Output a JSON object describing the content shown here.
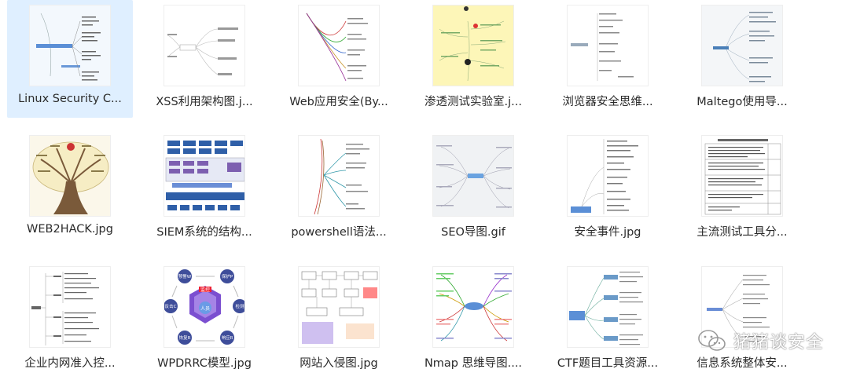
{
  "files": [
    {
      "name": "Linux Security C...",
      "icon": "mindmap-light-blue-icon",
      "selected": true
    },
    {
      "name": "XSS利用架构图.j...",
      "icon": "mindmap-xss-icon"
    },
    {
      "name": "Web应用安全(By...",
      "icon": "mindmap-web-security-icon"
    },
    {
      "name": "渗透测试实验室.j...",
      "icon": "mindmap-yellow-icon"
    },
    {
      "name": "浏览器安全思维...",
      "icon": "mindmap-browser-icon"
    },
    {
      "name": "Maltego使用导...",
      "icon": "mindmap-maltego-icon"
    },
    {
      "name": "WEB2HACK.jpg",
      "icon": "tree-diagram-icon"
    },
    {
      "name": "SIEM系统的结构...",
      "icon": "siem-architecture-icon"
    },
    {
      "name": "powershell语法...",
      "icon": "mindmap-powershell-icon"
    },
    {
      "name": "SEO导图.gif",
      "icon": "mindmap-seo-icon"
    },
    {
      "name": "安全事件.jpg",
      "icon": "mindmap-events-icon"
    },
    {
      "name": "主流测试工具分...",
      "icon": "table-document-icon"
    },
    {
      "name": "企业内网准入控...",
      "icon": "mindmap-intranet-icon"
    },
    {
      "name": "WPDRRC模型.jpg",
      "icon": "wpdrrc-model-icon"
    },
    {
      "name": "网站入侵图.jpg",
      "icon": "flowchart-intrusion-icon"
    },
    {
      "name": "Nmap 思维导图....",
      "icon": "mindmap-nmap-icon"
    },
    {
      "name": "CTF题目工具资源...",
      "icon": "mindmap-ctf-icon"
    },
    {
      "name": "信息系统整体安...",
      "icon": "mindmap-infosys-icon"
    }
  ],
  "wpdrrc": {
    "center_top": "监控",
    "center_bottom": "人员",
    "nodes": [
      "预警W",
      "保护P",
      "检测",
      "响应R",
      "恢复R",
      "反击C"
    ]
  },
  "watermark": {
    "text": "猪猪谈安全",
    "icon": "wechat-icon"
  }
}
